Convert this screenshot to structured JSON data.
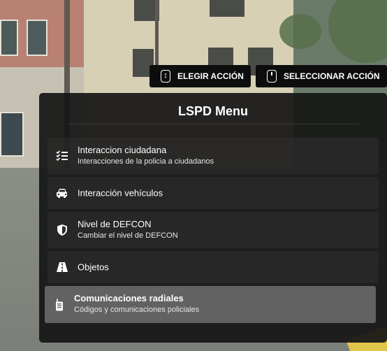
{
  "hints": [
    {
      "label": "ELEGIR ACCIÓN",
      "icon": "arrow-keys-icon"
    },
    {
      "label": "SELECCIONAR ACCIÓN",
      "icon": "mouse-click-icon"
    }
  ],
  "menu": {
    "title": "LSPD Menu",
    "items": [
      {
        "title": "Interaccion ciudadana",
        "subtitle": "Interacciones de la policia a ciudadanos",
        "icon": "checklist-icon"
      },
      {
        "title": "Interacción vehículos",
        "icon": "car-icon"
      },
      {
        "title": "Nivel de DEFCON",
        "subtitle": "Cambiar el nivel de DEFCON",
        "icon": "shield-icon"
      },
      {
        "title": "Objetos",
        "icon": "road-icon"
      },
      {
        "title": "Comunicaciones radiales",
        "subtitle": "Códigos y comunicaciones policiales",
        "icon": "walkie-talkie-icon",
        "selected": true
      }
    ]
  }
}
